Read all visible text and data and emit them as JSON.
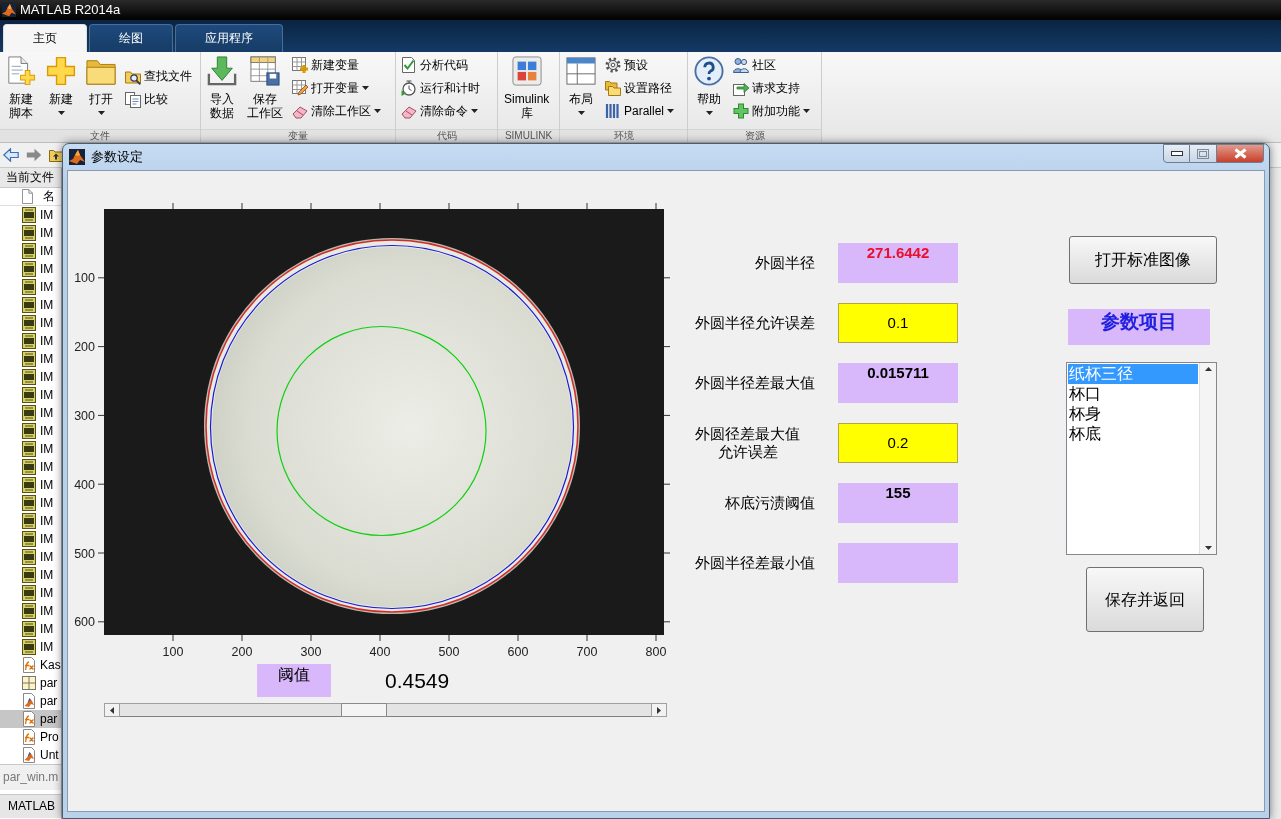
{
  "app": {
    "title": "MATLAB R2014a"
  },
  "ribbon": {
    "tabs": [
      {
        "label": "主页",
        "selected": true
      },
      {
        "label": "绘图",
        "selected": false
      },
      {
        "label": "应用程序",
        "selected": false
      }
    ],
    "groups": [
      {
        "label": "文件",
        "items": [
          {
            "kind": "large",
            "lines": [
              "新建",
              "脚本"
            ],
            "dropdown": false
          },
          {
            "kind": "large",
            "lines": [
              "新建"
            ],
            "dropdown": true
          },
          {
            "kind": "large",
            "lines": [
              "打开"
            ],
            "dropdown": true
          },
          {
            "kind": "small",
            "lines": [
              "查找文件"
            ],
            "dropdown": false
          },
          {
            "kind": "small",
            "lines": [
              "比较"
            ],
            "dropdown": false
          }
        ]
      },
      {
        "label": "变量",
        "items": [
          {
            "kind": "large",
            "lines": [
              "导入",
              "数据"
            ],
            "dropdown": false
          },
          {
            "kind": "large",
            "lines": [
              "保存",
              "工作区"
            ],
            "dropdown": false
          },
          {
            "kind": "small",
            "lines": [
              "新建变量"
            ],
            "dropdown": false
          },
          {
            "kind": "small",
            "lines": [
              "打开变量"
            ],
            "dropdown": true
          },
          {
            "kind": "small",
            "lines": [
              "清除工作区"
            ],
            "dropdown": true
          }
        ]
      },
      {
        "label": "代码",
        "items": [
          {
            "kind": "small",
            "lines": [
              "分析代码"
            ],
            "dropdown": false
          },
          {
            "kind": "small",
            "lines": [
              "运行和计时"
            ],
            "dropdown": false
          },
          {
            "kind": "small",
            "lines": [
              "清除命令"
            ],
            "dropdown": true
          }
        ]
      },
      {
        "label": "SIMULINK",
        "items": [
          {
            "kind": "large",
            "lines": [
              "Simulink",
              "库"
            ],
            "dropdown": false
          }
        ]
      },
      {
        "label": "环境",
        "items": [
          {
            "kind": "large",
            "lines": [
              "布局"
            ],
            "dropdown": true
          },
          {
            "kind": "small",
            "lines": [
              "预设"
            ],
            "dropdown": false
          },
          {
            "kind": "small",
            "lines": [
              "设置路径"
            ],
            "dropdown": false
          },
          {
            "kind": "small",
            "lines": [
              "Parallel"
            ],
            "dropdown": true
          }
        ]
      },
      {
        "label": "资源",
        "items": [
          {
            "kind": "large",
            "lines": [
              "帮助"
            ],
            "dropdown": true
          },
          {
            "kind": "small",
            "lines": [
              "社区"
            ],
            "dropdown": false
          },
          {
            "kind": "small",
            "lines": [
              "请求支持"
            ],
            "dropdown": false
          },
          {
            "kind": "small",
            "lines": [
              "附加功能"
            ],
            "dropdown": true
          }
        ]
      }
    ]
  },
  "current_folder": {
    "title": "当前文件",
    "column_header": "名",
    "files": [
      {
        "kind": "image",
        "name": "IM",
        "selected": false
      },
      {
        "kind": "image",
        "name": "IM",
        "selected": false
      },
      {
        "kind": "image",
        "name": "IM",
        "selected": false
      },
      {
        "kind": "image",
        "name": "IM",
        "selected": false
      },
      {
        "kind": "image",
        "name": "IM",
        "selected": false
      },
      {
        "kind": "image",
        "name": "IM",
        "selected": false
      },
      {
        "kind": "image",
        "name": "IM",
        "selected": false
      },
      {
        "kind": "image",
        "name": "IM",
        "selected": false
      },
      {
        "kind": "image",
        "name": "IM",
        "selected": false
      },
      {
        "kind": "image",
        "name": "IM",
        "selected": false
      },
      {
        "kind": "image",
        "name": "IM",
        "selected": false
      },
      {
        "kind": "image",
        "name": "IM",
        "selected": false
      },
      {
        "kind": "image",
        "name": "IM",
        "selected": false
      },
      {
        "kind": "image",
        "name": "IM",
        "selected": false
      },
      {
        "kind": "image",
        "name": "IM",
        "selected": false
      },
      {
        "kind": "image",
        "name": "IM",
        "selected": false
      },
      {
        "kind": "image",
        "name": "IM",
        "selected": false
      },
      {
        "kind": "image",
        "name": "IM",
        "selected": false
      },
      {
        "kind": "image",
        "name": "IM",
        "selected": false
      },
      {
        "kind": "image",
        "name": "IM",
        "selected": false
      },
      {
        "kind": "image",
        "name": "IM",
        "selected": false
      },
      {
        "kind": "image",
        "name": "IM",
        "selected": false
      },
      {
        "kind": "image",
        "name": "IM",
        "selected": false
      },
      {
        "kind": "image",
        "name": "IM",
        "selected": false
      },
      {
        "kind": "image",
        "name": "IM",
        "selected": false
      },
      {
        "kind": "function",
        "name": "Kas",
        "selected": false
      },
      {
        "kind": "table",
        "name": "par",
        "selected": false
      },
      {
        "kind": "figure",
        "name": "par",
        "selected": false
      },
      {
        "kind": "function",
        "name": "par",
        "selected": true
      },
      {
        "kind": "function",
        "name": "Pro",
        "selected": false
      },
      {
        "kind": "figure",
        "name": "Unt",
        "selected": false
      }
    ],
    "details": "par_win.m"
  },
  "command_window": {
    "title": "MATLAB"
  },
  "dialog": {
    "title": "参数设定",
    "image_axes": {
      "x_tick_labels": [
        "100",
        "200",
        "300",
        "400",
        "500",
        "600",
        "700",
        "800"
      ],
      "y_tick_labels": [
        "100",
        "200",
        "300",
        "400",
        "500",
        "600"
      ]
    },
    "threshold": {
      "label": "阈值",
      "value": "0.4549"
    },
    "slider": {
      "level": 0.4549
    },
    "fields": [
      {
        "kind": "display",
        "label_lines": [
          "外圆半径"
        ],
        "value": "271.6442",
        "color": "#e8102c"
      },
      {
        "kind": "edit",
        "label_lines": [
          "外圆半径允许误差"
        ],
        "value": "0.1"
      },
      {
        "kind": "display",
        "label_lines": [
          "外圆半径差最大值"
        ],
        "value": "0.015711",
        "color": "#000000"
      },
      {
        "kind": "edit",
        "label_lines": [
          "外圆径差最大值",
          "允许误差"
        ],
        "value": "0.2"
      },
      {
        "kind": "display",
        "label_lines": [
          "杯底污渍阈值"
        ],
        "value": "155",
        "color": "#000000"
      },
      {
        "kind": "display",
        "label_lines": [
          "外圆半径差最小值"
        ]
      }
    ],
    "open_button": "打开标准图像",
    "list_title": "参数项目",
    "list_items": [
      {
        "label": "纸杯三径",
        "selected": true
      },
      {
        "label": "杯口",
        "selected": false
      },
      {
        "label": "杯身",
        "selected": false
      },
      {
        "label": "杯底",
        "selected": false
      }
    ],
    "save_button": "保存并返回"
  }
}
